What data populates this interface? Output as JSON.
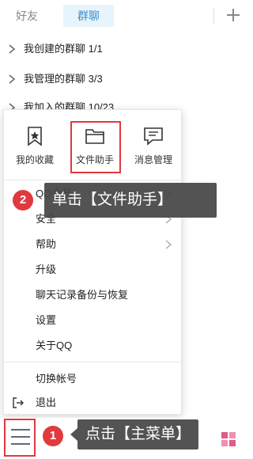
{
  "tabs": {
    "friends": "好友",
    "groups": "群聊"
  },
  "group_list": [
    {
      "label": "我创建的群聊  1/1"
    },
    {
      "label": "我管理的群聊  3/3"
    },
    {
      "label": "我加入的群聊  10/23"
    }
  ],
  "menu": {
    "quick": [
      {
        "label": "我的收藏",
        "icon": "bookmark-star-icon"
      },
      {
        "label": "文件助手",
        "icon": "folder-icon"
      },
      {
        "label": "消息管理",
        "icon": "message-icon"
      }
    ],
    "items": [
      {
        "label": "QQ会员",
        "has_arrow": true
      },
      {
        "label": "安全",
        "has_arrow": true
      },
      {
        "label": "帮助",
        "has_arrow": true
      },
      {
        "label": "升级",
        "has_arrow": false
      },
      {
        "label": "聊天记录备份与恢复",
        "has_arrow": false
      },
      {
        "label": "设置",
        "has_arrow": false
      },
      {
        "label": "关于QQ",
        "has_arrow": false
      }
    ],
    "bottom_items": [
      {
        "label": "切换帐号"
      },
      {
        "label": "退出",
        "icon": "exit-icon"
      }
    ]
  },
  "annotations": {
    "step1_number": "1",
    "step1_text": "点击【主菜单】",
    "step2_number": "2",
    "step2_text": "单击【文件助手】"
  },
  "colors": {
    "accent": "#3a8fd0",
    "highlight_red": "#e0393e",
    "tooltip_bg": "#464646"
  }
}
